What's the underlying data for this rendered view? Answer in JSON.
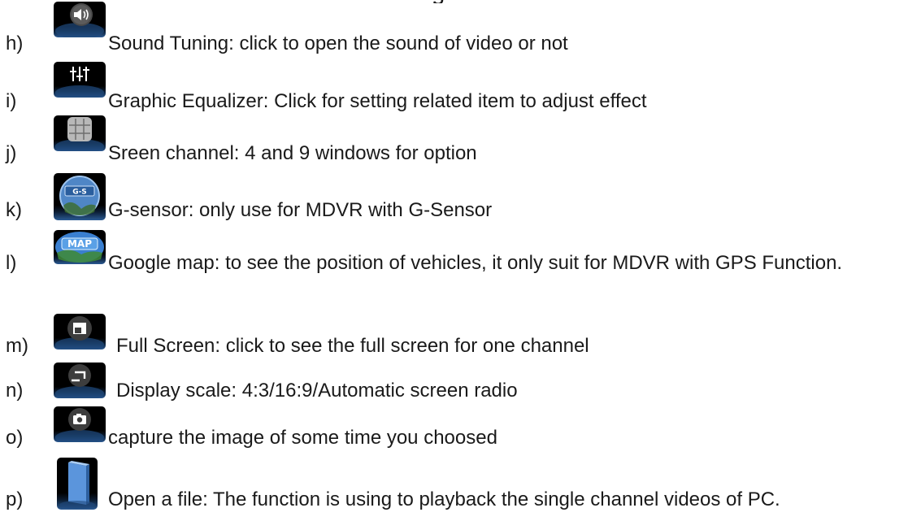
{
  "items": [
    {
      "letter": "h)",
      "icon": "speaker-icon",
      "text": "Sound Tuning: click to open the sound of video or not"
    },
    {
      "letter": "i)",
      "icon": "equalizer-icon",
      "text": "Graphic Equalizer: Click for setting related item to adjust effect"
    },
    {
      "letter": "j)",
      "icon": "grid-icon",
      "text": "Sreen channel: 4 and 9 windows for option"
    },
    {
      "letter": "k)",
      "icon": "g-sensor-globe-icon",
      "icon_label": "G-S",
      "text": "G-sensor: only use for MDVR with G-Sensor"
    },
    {
      "letter": "l)",
      "icon": "map-icon",
      "icon_label": "MAP",
      "text": "Google map: to see the position of vehicles, it only suit for MDVR with GPS Function."
    },
    {
      "letter": "m)",
      "icon": "full-screen-icon",
      "text": "Full Screen: click to see the full screen for one channel"
    },
    {
      "letter": "n)",
      "icon": "display-scale-icon",
      "text": "Display scale: 4:3/16:9/Automatic screen radio"
    },
    {
      "letter": "o)",
      "icon": "camera-icon",
      "text": "capture the image of some time you choosed"
    },
    {
      "letter": "p)",
      "icon": "open-file-icon",
      "text": "Open a file: The function is using to playback the single channel videos of PC."
    }
  ]
}
